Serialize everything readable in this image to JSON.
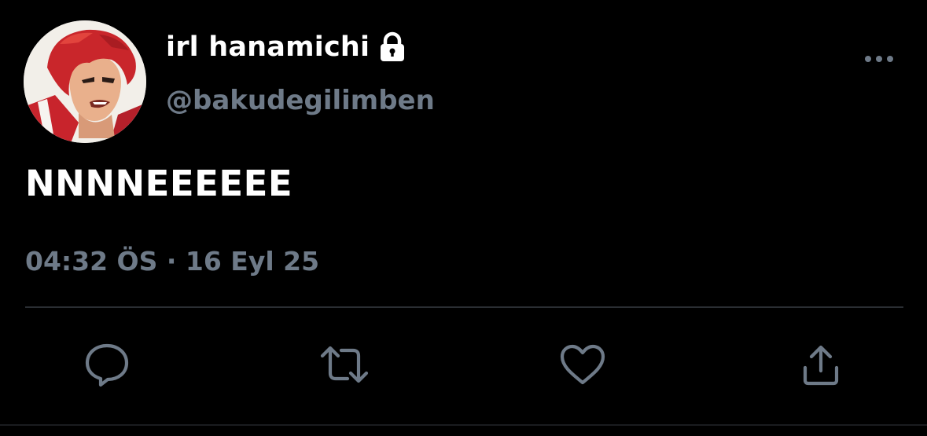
{
  "tweet": {
    "display_name": "irl hanamichi",
    "handle": "@bakudegilimben",
    "text": "NNNNEEEEEE",
    "timestamp": "04:32 ÖS · 16 Eyl 25",
    "protected_icon": "lock-icon",
    "more_icon": "more-dots-icon"
  },
  "actions": [
    {
      "name": "reply",
      "icon": "reply-icon"
    },
    {
      "name": "retweet",
      "icon": "retweet-icon"
    },
    {
      "name": "like",
      "icon": "heart-icon"
    },
    {
      "name": "share",
      "icon": "share-icon"
    }
  ],
  "colors": {
    "background": "#000000",
    "primary_text": "#ffffff",
    "secondary_text": "#6e7a88",
    "divider": "#2a2e33"
  }
}
